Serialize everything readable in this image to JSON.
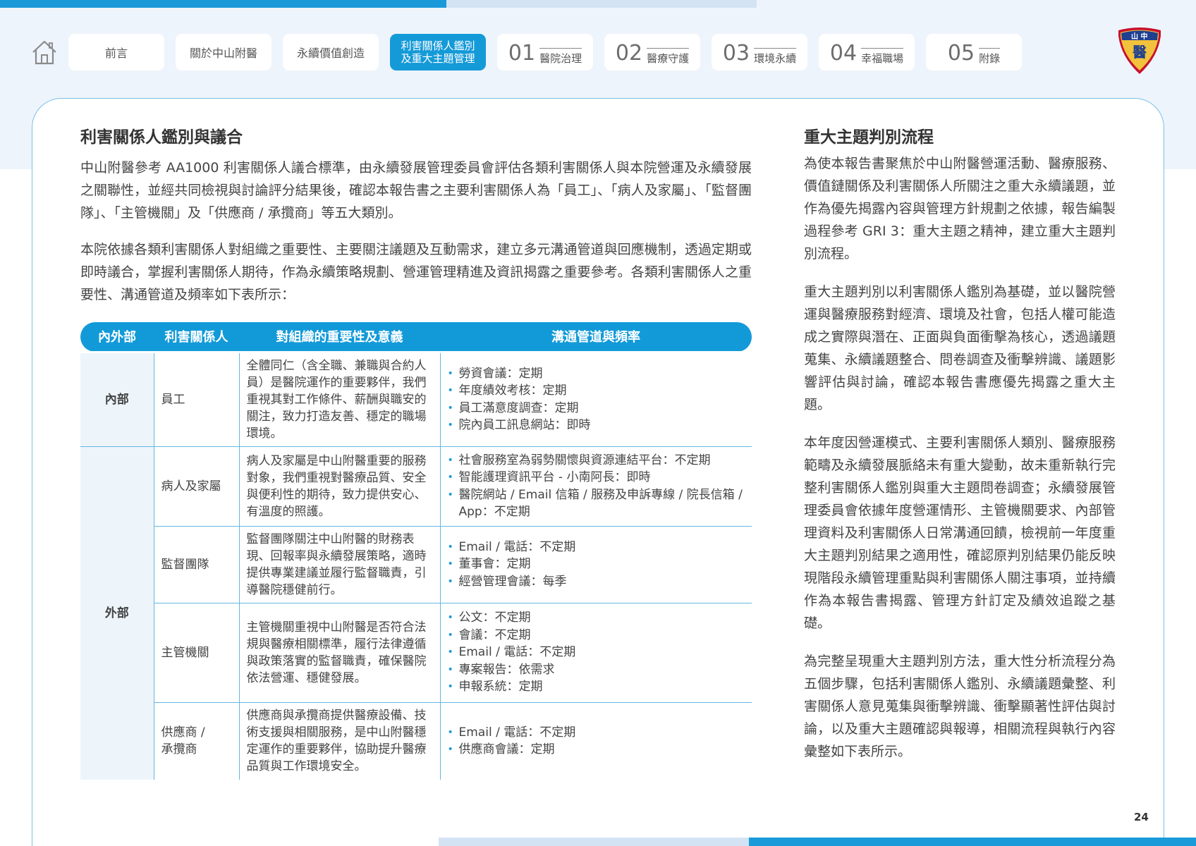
{
  "nav": {
    "tabs": [
      {
        "label": "前言"
      },
      {
        "label": "關於中山附醫"
      },
      {
        "label": "永續價值創造"
      },
      {
        "label": "利害關係人鑑別\n及重大主題管理",
        "active": true
      }
    ],
    "numbered_tabs": [
      {
        "num": "01",
        "label": "醫院治理"
      },
      {
        "num": "02",
        "label": "醫療守護"
      },
      {
        "num": "03",
        "label": "環境永續"
      },
      {
        "num": "04",
        "label": "幸福職場"
      },
      {
        "num": "05",
        "label": "附錄"
      }
    ]
  },
  "logo": {
    "text_top": "山 中",
    "text_mid": "醫"
  },
  "left": {
    "title": "利害關係人鑑別與議合",
    "para1": "中山附醫參考 AA1000 利害關係人議合標準，由永續發展管理委員會評估各類利害關係人與本院營運及永續發展之關聯性，並經共同檢視與討論評分結果後，確認本報告書之主要利害關係人為「員工」、「病人及家屬」、「監督團隊」、「主管機關」及「供應商 / 承攬商」等五大類別。",
    "para2": "本院依據各類利害關係人對組織之重要性、主要關注議題及互動需求，建立多元溝通管道與回應機制，透過定期或即時議合，掌握利害關係人期待，作為永續策略規劃、營運管理精進及資訊揭露之重要參考。各類利害關係人之重要性、溝通管道及頻率如下表所示："
  },
  "table": {
    "headers": [
      "內外部",
      "利害關係人",
      "對組織的重要性及意義",
      "溝通管道與頻率"
    ],
    "groups": [
      {
        "category": "內部",
        "rows": [
          {
            "name": "員工",
            "desc": "全體同仁（含全職、兼職與合約人員）是醫院運作的重要夥伴，我們重視其對工作條件、薪酬與職安的關注，致力打造友善、穩定的職場環境。",
            "channels": [
              "勞資會議：定期",
              "年度績效考核：定期",
              "員工滿意度調查：定期",
              "院內員工訊息網站：即時"
            ]
          }
        ]
      },
      {
        "category": "外部",
        "rows": [
          {
            "name": "病人及家屬",
            "desc": "病人及家屬是中山附醫重要的服務對象，我們重視對醫療品質、安全與便利性的期待，致力提供安心、有溫度的照護。",
            "channels": [
              "社會服務室為弱勢關懷與資源連結平台：不定期",
              "智能護理資訊平台 - 小南阿長：即時",
              "醫院網站 / Email 信箱 / 服務及申訴專線 / 院長信箱 / App：不定期"
            ]
          },
          {
            "name": "監督團隊",
            "desc": "監督團隊關注中山附醫的財務表現、回報率與永續發展策略，適時提供專業建議並履行監督職責，引導醫院穩健前行。",
            "channels": [
              "Email / 電話：不定期",
              "董事會：定期",
              "經營管理會議：每季"
            ]
          },
          {
            "name": "主管機關",
            "desc": "主管機關重視中山附醫是否符合法規與醫療相關標準，履行法律遵循與政策落實的監督職責，確保醫院依法營運、穩健發展。",
            "channels": [
              "公文：不定期",
              "會議：不定期",
              "Email / 電話：不定期",
              "專案報告：依需求",
              "申報系統：定期"
            ]
          },
          {
            "name": "供應商 /\n承攬商",
            "desc": "供應商與承攬商提供醫療設備、技術支援與相關服務，是中山附醫穩定運作的重要夥伴，協助提升醫療品質與工作環境安全。",
            "channels": [
              "Email / 電話：不定期",
              "供應商會議：定期"
            ]
          }
        ]
      }
    ]
  },
  "right": {
    "title": "重大主題判別流程",
    "paras": [
      "為使本報告書聚焦於中山附醫營運活動、醫療服務、價值鏈關係及利害關係人所關注之重大永續議題，並作為優先揭露內容與管理方針規劃之依據，報告編製過程參考 GRI 3：重大主題之精神，建立重大主題判別流程。",
      "重大主題判別以利害關係人鑑別為基礎，並以醫院營運與醫療服務對經濟、環境及社會，包括人權可能造成之實際與潛在、正面與負面衝擊為核心，透過議題蒐集、永續議題整合、問卷調查及衝擊辨識、議題影響評估與討論，確認本報告書應優先揭露之重大主題。",
      "本年度因營運模式、主要利害關係人類別、醫療服務範疇及永續發展脈絡未有重大變動，故未重新執行完整利害關係人鑑別與重大主題問卷調查；永續發展管理委員會依據年度營運情形、主管機關要求、內部管理資料及利害關係人日常溝通回饋，檢視前一年度重大主題判別結果之適用性，確認原判別結果仍能反映現階段永續管理重點與利害關係人關注事項，並持續作為本報告書揭露、管理方針訂定及績效追蹤之基礎。",
      "為完整呈現重大主題判別方法，重大性分析流程分為五個步驟，包括利害關係人鑑別、永續議題彙整、利害關係人意見蒐集與衝擊辨識、衝擊顯著性評估與討論，以及重大主題確認與報導，相關流程與執行內容彙整如下表所示。"
    ]
  },
  "page_number": "24",
  "colors": {
    "accent": "#1a9ad9",
    "light_band": "#eef4fb",
    "table_border": "#64b8e2"
  }
}
